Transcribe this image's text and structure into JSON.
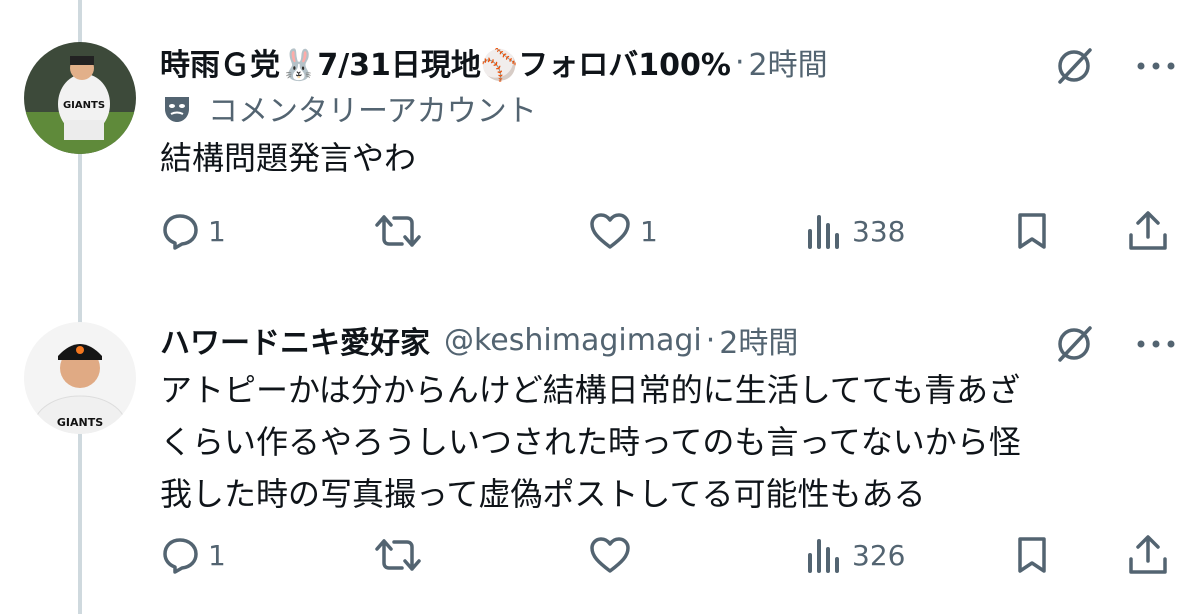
{
  "tweets": [
    {
      "name": "時雨Ｇ党🐰7/31日現地⚾️フォロバ100%",
      "dot": "·",
      "time": "2時間",
      "commentary": "コメンタリーアカウント",
      "text_lines": [
        "結構問題発言やわ"
      ],
      "replies": "1",
      "retweets": "",
      "likes": "1",
      "views": "338"
    },
    {
      "name": "ハワードニキ愛好家",
      "handle": "@keshimagimagi",
      "dot": "·",
      "time": "2時間",
      "text_lines": [
        "アトピーかは分からんけど結構日常的に生活してても青あざ",
        "くらい作るやろうしいつされた時ってのも言ってないから怪",
        "我した時の写真撮って虚偽ポストしてる可能性もある"
      ],
      "replies": "1",
      "retweets": "",
      "likes": "",
      "views": "326"
    }
  ],
  "icons": {
    "grok": "grok-icon",
    "more": "more-icon",
    "reply": "reply-icon",
    "retweet": "retweet-icon",
    "like": "like-icon",
    "views": "views-icon",
    "bookmark": "bookmark-icon",
    "share": "share-icon",
    "commentary": "mask-icon"
  },
  "colors": {
    "secondary_text": "#536471",
    "text": "#0f1419",
    "thread_line": "#cfd9de"
  }
}
